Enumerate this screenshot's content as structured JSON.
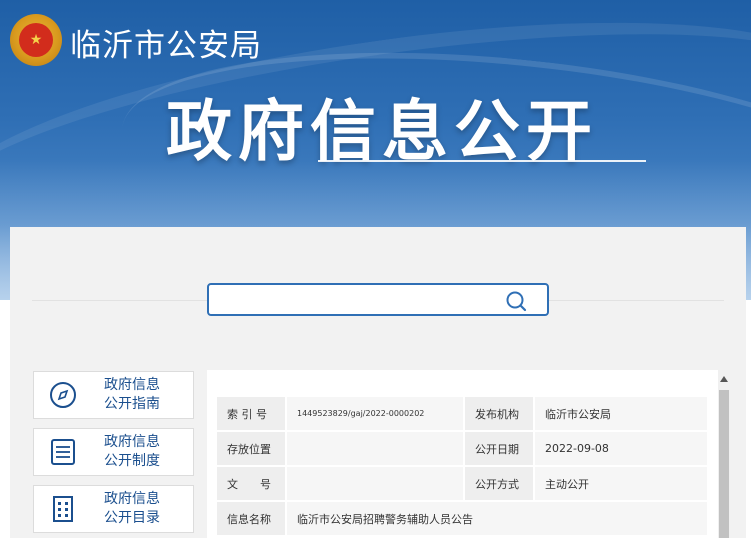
{
  "header": {
    "agency_name": "临沂市公安局",
    "title": "政府信息公开"
  },
  "search": {
    "placeholder": "",
    "icon": "search-icon"
  },
  "sidebar": {
    "items": [
      {
        "line1": "政府信息",
        "line2": "公开指南",
        "icon": "compass-icon"
      },
      {
        "line1": "政府信息",
        "line2": "公开制度",
        "icon": "document-icon"
      },
      {
        "line1": "政府信息",
        "line2": "公开目录",
        "icon": "grid-list-icon"
      }
    ]
  },
  "info": {
    "rows": [
      {
        "k1": "索 引 号",
        "v1": "1449523829/gaj/2022-0000202",
        "k2": "发布机构",
        "v2": "临沂市公安局"
      },
      {
        "k1": "存放位置",
        "v1": "",
        "k2": "公开日期",
        "v2": "2022-09-08"
      },
      {
        "k1": "文　　号",
        "v1": "",
        "k2": "公开方式",
        "v2": "主动公开"
      }
    ],
    "name_label": "信息名称",
    "name_value": "临沂市公安局招聘警务辅助人员公告"
  },
  "colors": {
    "brand_blue": "#2f6fb5",
    "link_blue": "#1b4f8e"
  }
}
